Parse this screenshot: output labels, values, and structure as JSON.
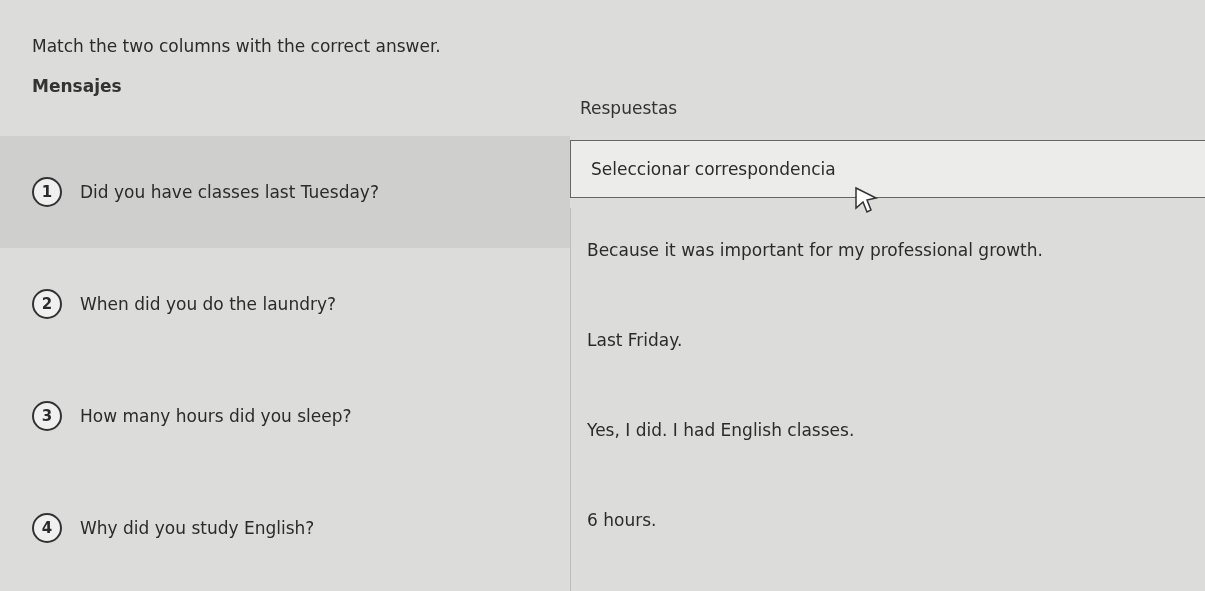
{
  "instruction": "Match the two columns with the correct answer.",
  "messages_heading": "Mensajes",
  "answers_heading": "Respuestas",
  "messages": [
    {
      "number": "1",
      "text": "Did you have classes last Tuesday?",
      "selected": true
    },
    {
      "number": "2",
      "text": "When did you do the laundry?",
      "selected": false
    },
    {
      "number": "3",
      "text": "How many hours did you sleep?",
      "selected": false
    },
    {
      "number": "4",
      "text": "Why did you study English?",
      "selected": false
    }
  ],
  "match_select": {
    "placeholder": "Seleccionar correspondencia"
  },
  "answers": [
    "Because it was important for my professional growth.",
    "Last Friday.",
    "Yes, I did. I had English classes.",
    "6 hours."
  ]
}
